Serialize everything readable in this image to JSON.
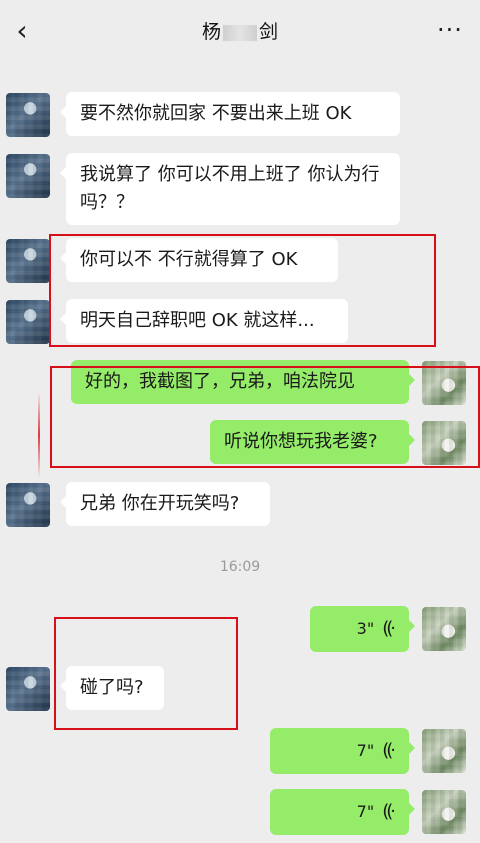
{
  "header": {
    "back_icon": "chevron-left",
    "title_prefix": "杨",
    "title_suffix": "剑",
    "more_label": "···"
  },
  "messages": [
    {
      "side": "in",
      "text": "要不然你就回家 不要出来上班 OK"
    },
    {
      "side": "in",
      "text": "我说算了 你可以不用上班了 你认为行吗？？"
    },
    {
      "side": "in",
      "text": "你可以不 不行就得算了 OK"
    },
    {
      "side": "in",
      "text": "明天自己辞职吧 OK 就这样..."
    },
    {
      "side": "out",
      "text": "好的，我截图了，兄弟，咱法院见"
    },
    {
      "side": "out",
      "text": "听说你想玩我老婆?"
    },
    {
      "side": "in",
      "text": "兄弟 你在开玩笑吗?"
    },
    {
      "side": "out",
      "type": "voice",
      "duration": "3\""
    },
    {
      "side": "in",
      "text": "碰了吗?"
    },
    {
      "side": "out",
      "type": "voice",
      "duration": "7\""
    },
    {
      "side": "out",
      "type": "voice",
      "duration": "7\""
    }
  ],
  "timestamp": "16:09",
  "colors": {
    "background": "#ededed",
    "incoming_bubble": "#ffffff",
    "outgoing_bubble": "#95ec69",
    "highlight_box": "#d60f18"
  }
}
